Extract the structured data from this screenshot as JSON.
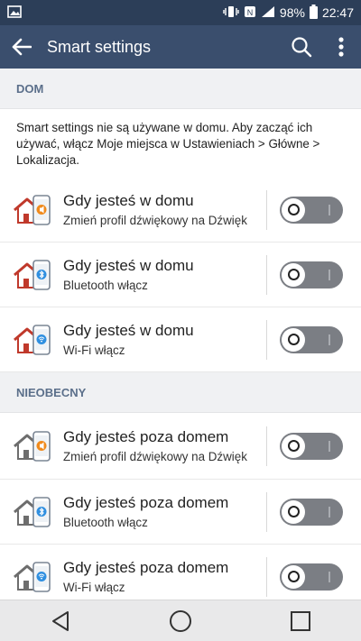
{
  "status_bar": {
    "battery": "98%",
    "time": "22:47"
  },
  "app_bar": {
    "title": "Smart settings"
  },
  "sections": [
    {
      "header": "DOM",
      "info": "Smart settings nie są używane w domu. Aby zacząć ich używać, włącz Moje miejsca w Ustawieniach > Główne > Lokalizacja.",
      "rows": [
        {
          "title": "Gdy jesteś w domu",
          "subtitle": "Zmień profil dźwiękowy na Dźwięk",
          "icon": "home-sound-icon",
          "enabled": false
        },
        {
          "title": "Gdy jesteś w domu",
          "subtitle": "Bluetooth włącz",
          "icon": "home-bluetooth-icon",
          "enabled": false
        },
        {
          "title": "Gdy jesteś w domu",
          "subtitle": "Wi-Fi włącz",
          "icon": "home-wifi-icon",
          "enabled": false
        }
      ]
    },
    {
      "header": "NIEOBECNY",
      "rows": [
        {
          "title": "Gdy jesteś poza domem",
          "subtitle": "Zmień profil dźwiękowy na Dźwięk",
          "icon": "away-sound-icon",
          "enabled": false
        },
        {
          "title": "Gdy jesteś poza domem",
          "subtitle": "Bluetooth włącz",
          "icon": "away-bluetooth-icon",
          "enabled": false
        },
        {
          "title": "Gdy jesteś poza domem",
          "subtitle": "Wi-Fi włącz",
          "icon": "away-wifi-icon",
          "enabled": false
        }
      ]
    }
  ],
  "colors": {
    "status_bar": "#2c3e58",
    "app_bar": "#3a4e6d",
    "section_header_bg": "#f0f1f3",
    "section_header_text": "#5b6f8a",
    "toggle_off": "#7b7e84",
    "house_home_roof": "#c0392b",
    "house_away_roof": "#6d6d6d",
    "accent_sound": "#f08a1c",
    "accent_bluetooth": "#2f8fe0"
  }
}
